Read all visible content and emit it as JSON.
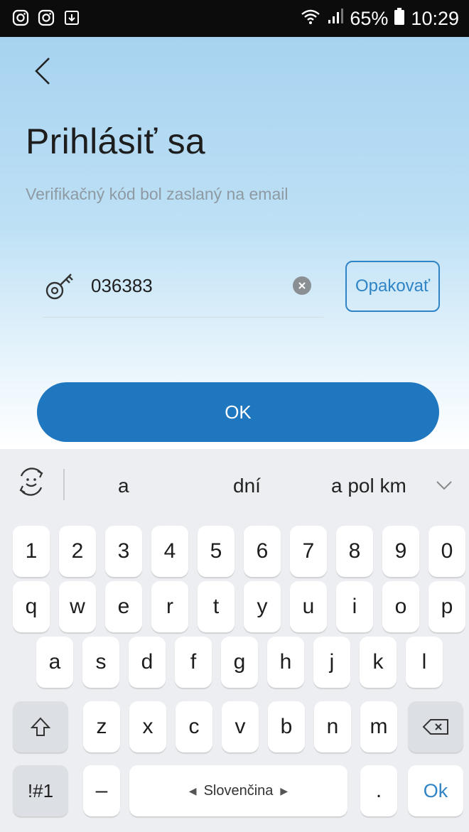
{
  "status_bar": {
    "left_icons": [
      "instagram-icon",
      "instagram-icon",
      "download-icon"
    ],
    "battery": "65%",
    "time": "10:29",
    "icons": [
      "wifi-icon",
      "signal-icon",
      "battery-icon"
    ]
  },
  "login": {
    "title": "Prihlásiť sa",
    "subtitle": "Verifikačný kód bol zaslaný na email",
    "code_value": "036383",
    "resend_label": "Opakovať",
    "ok_label": "OK"
  },
  "colors": {
    "accent": "#1f77c0",
    "resend": "#2f84c6"
  },
  "keyboard": {
    "suggestions": [
      "a",
      "dní",
      "a pol km"
    ],
    "row_numbers": [
      "1",
      "2",
      "3",
      "4",
      "5",
      "6",
      "7",
      "8",
      "9",
      "0"
    ],
    "row_top": [
      "q",
      "w",
      "e",
      "r",
      "t",
      "y",
      "u",
      "i",
      "o",
      "p"
    ],
    "row_middle": [
      "a",
      "s",
      "d",
      "f",
      "g",
      "h",
      "j",
      "k",
      "l"
    ],
    "row_bottom": [
      "z",
      "x",
      "c",
      "v",
      "b",
      "n",
      "m"
    ],
    "symbols_label": "!#1",
    "dash_label": "–",
    "space_label": "Slovenčina",
    "period_label": ".",
    "enter_label": "Ok"
  }
}
